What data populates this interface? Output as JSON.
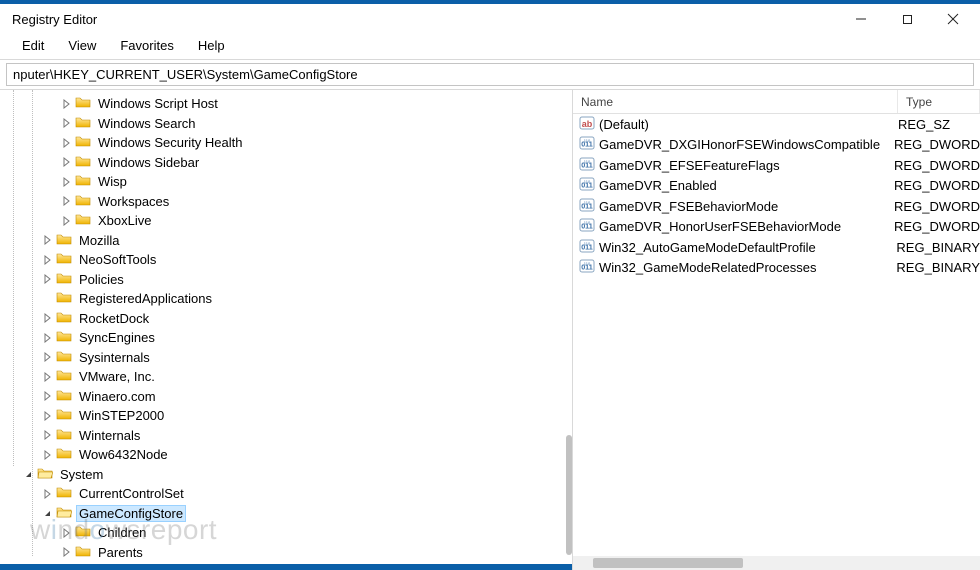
{
  "window": {
    "title": "Registry Editor"
  },
  "menu": {
    "edit": "Edit",
    "view": "View",
    "favorites": "Favorites",
    "help": "Help"
  },
  "address": {
    "value": "nputer\\HKEY_CURRENT_USER\\System\\GameConfigStore"
  },
  "tree": {
    "items": [
      {
        "indent": 3,
        "expander": "closed",
        "label": "Windows Script Host"
      },
      {
        "indent": 3,
        "expander": "closed",
        "label": "Windows Search"
      },
      {
        "indent": 3,
        "expander": "closed",
        "label": "Windows Security Health"
      },
      {
        "indent": 3,
        "expander": "closed",
        "label": "Windows Sidebar"
      },
      {
        "indent": 3,
        "expander": "closed",
        "label": "Wisp"
      },
      {
        "indent": 3,
        "expander": "closed",
        "label": "Workspaces"
      },
      {
        "indent": 3,
        "expander": "closed",
        "label": "XboxLive"
      },
      {
        "indent": 2,
        "expander": "closed",
        "label": "Mozilla"
      },
      {
        "indent": 2,
        "expander": "closed",
        "label": "NeoSoftTools"
      },
      {
        "indent": 2,
        "expander": "closed",
        "label": "Policies"
      },
      {
        "indent": 2,
        "expander": "none",
        "label": "RegisteredApplications"
      },
      {
        "indent": 2,
        "expander": "closed",
        "label": "RocketDock"
      },
      {
        "indent": 2,
        "expander": "closed",
        "label": "SyncEngines"
      },
      {
        "indent": 2,
        "expander": "closed",
        "label": "Sysinternals"
      },
      {
        "indent": 2,
        "expander": "closed",
        "label": "VMware, Inc."
      },
      {
        "indent": 2,
        "expander": "closed",
        "label": "Winaero.com"
      },
      {
        "indent": 2,
        "expander": "closed",
        "label": "WinSTEP2000"
      },
      {
        "indent": 2,
        "expander": "closed",
        "label": "Winternals"
      },
      {
        "indent": 2,
        "expander": "closed",
        "label": "Wow6432Node"
      },
      {
        "indent": 1,
        "expander": "open",
        "label": "System"
      },
      {
        "indent": 2,
        "expander": "closed",
        "label": "CurrentControlSet"
      },
      {
        "indent": 2,
        "expander": "open",
        "label": "GameConfigStore",
        "selected": true
      },
      {
        "indent": 3,
        "expander": "closed",
        "label": "Children"
      },
      {
        "indent": 3,
        "expander": "closed",
        "label": "Parents"
      }
    ]
  },
  "list": {
    "columns": {
      "name": "Name",
      "type": "Type"
    },
    "rows": [
      {
        "icon": "string",
        "name": "(Default)",
        "type": "REG_SZ"
      },
      {
        "icon": "bin",
        "name": "GameDVR_DXGIHonorFSEWindowsCompatible",
        "type": "REG_DWORD"
      },
      {
        "icon": "bin",
        "name": "GameDVR_EFSEFeatureFlags",
        "type": "REG_DWORD"
      },
      {
        "icon": "bin",
        "name": "GameDVR_Enabled",
        "type": "REG_DWORD"
      },
      {
        "icon": "bin",
        "name": "GameDVR_FSEBehaviorMode",
        "type": "REG_DWORD"
      },
      {
        "icon": "bin",
        "name": "GameDVR_HonorUserFSEBehaviorMode",
        "type": "REG_DWORD"
      },
      {
        "icon": "bin",
        "name": "Win32_AutoGameModeDefaultProfile",
        "type": "REG_BINARY"
      },
      {
        "icon": "bin",
        "name": "Win32_GameModeRelatedProcesses",
        "type": "REG_BINARY"
      }
    ]
  },
  "watermark": {
    "pre": "w",
    "accent": "i",
    "mid": "nd",
    "accent2": "o",
    "post": "wsreport"
  }
}
